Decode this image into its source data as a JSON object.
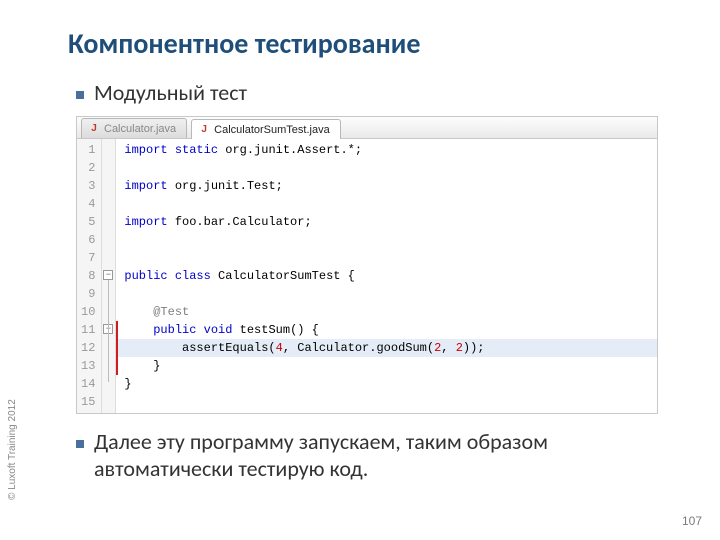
{
  "title": "Компонентное тестирование",
  "bullet1": "Модульный тест",
  "bullet2": "Далее эту программу запускаем, таким образом автоматически тестирую код.",
  "copyright": "© Luxoft Training 2012",
  "pageNumber": "107",
  "tabs": {
    "inactive": "Calculator.java",
    "active": "CalculatorSumTest.java"
  },
  "code": {
    "lines": [
      {
        "n": "1",
        "html": "<span class='kw'>import</span> <span class='kw'>static</span> org.junit.Assert.*;"
      },
      {
        "n": "2",
        "html": ""
      },
      {
        "n": "3",
        "html": "<span class='kw'>import</span> org.junit.Test;"
      },
      {
        "n": "4",
        "html": ""
      },
      {
        "n": "5",
        "html": "<span class='kw'>import</span> foo.bar.Calculator;"
      },
      {
        "n": "6",
        "html": ""
      },
      {
        "n": "7",
        "html": ""
      },
      {
        "n": "8",
        "html": "<span class='kw'>public</span> <span class='kw'>class</span> CalculatorSumTest {"
      },
      {
        "n": "9",
        "html": ""
      },
      {
        "n": "10",
        "html": "    <span class='an'>@Test</span>"
      },
      {
        "n": "11",
        "html": "    <span class='kw'>public</span> <span class='kw'>void</span> testSum() {"
      },
      {
        "n": "12",
        "html": "        assertEquals(<span class='num'>4</span>, Calculator.goodSum(<span class='num'>2</span>, <span class='num'>2</span>));",
        "hl": true
      },
      {
        "n": "13",
        "html": "    }"
      },
      {
        "n": "14",
        "html": "}"
      },
      {
        "n": "15",
        "html": ""
      }
    ]
  }
}
